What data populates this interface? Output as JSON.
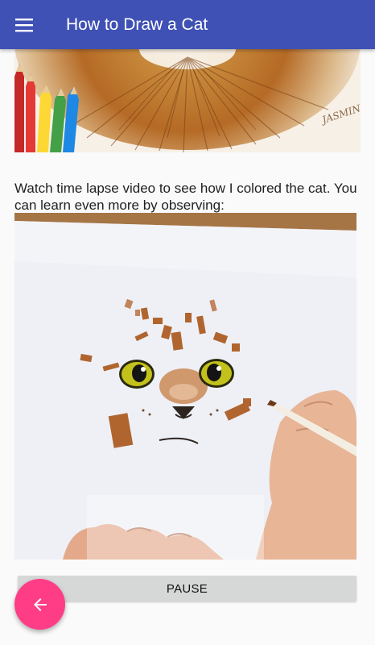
{
  "toolbar": {
    "title": "How to Draw a Cat",
    "menu_icon": "hamburger-menu-icon"
  },
  "content": {
    "top_image": {
      "signature": "JASMIN"
    },
    "description": "Watch time lapse video to see  how I colored the  cat. You can learn even more by observing:",
    "video": {
      "play_button_label": "PAUSE"
    }
  },
  "fab": {
    "icon": "arrow-left-icon"
  },
  "colors": {
    "primary": "#3f51b5",
    "accent": "#ff3d86",
    "button_bg": "#d6d7d7"
  }
}
